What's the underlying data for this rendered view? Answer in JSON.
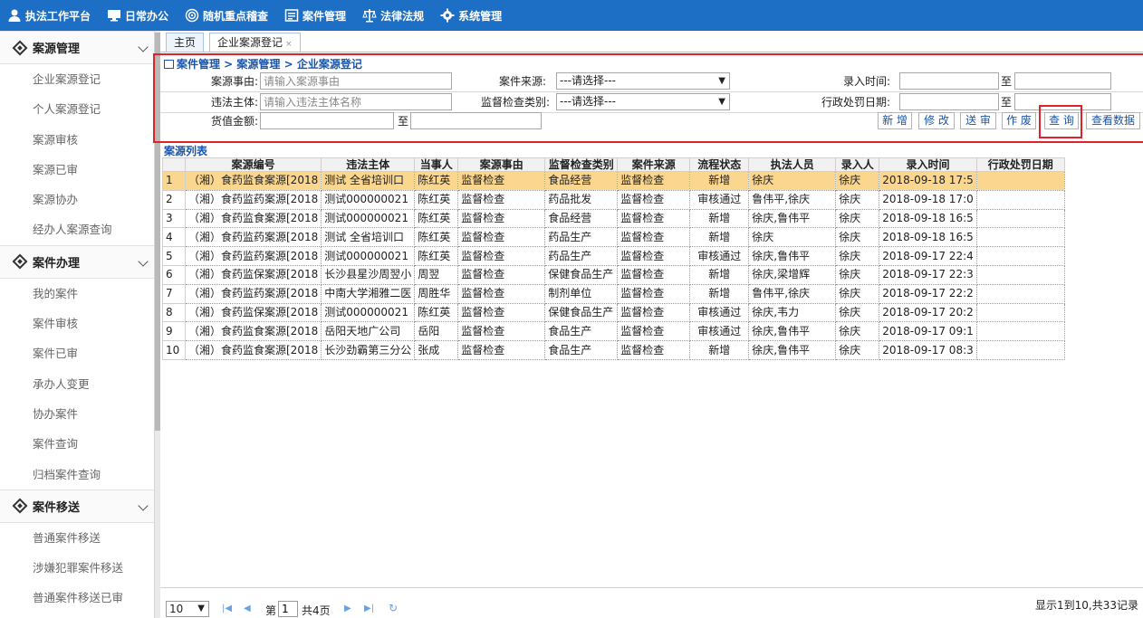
{
  "nav": {
    "items": [
      {
        "label": "执法工作平台",
        "icon": "user-icon"
      },
      {
        "label": "日常办公",
        "icon": "monitor-icon"
      },
      {
        "label": "随机重点稽查",
        "icon": "target-icon"
      },
      {
        "label": "案件管理",
        "icon": "list-icon"
      },
      {
        "label": "法律法规",
        "icon": "scale-icon"
      },
      {
        "label": "系统管理",
        "icon": "gear-icon"
      }
    ]
  },
  "sidebar": {
    "groups": [
      {
        "title": "案源管理",
        "items": [
          "企业案源登记",
          "个人案源登记",
          "案源审核",
          "案源已审",
          "案源协办",
          "经办人案源查询"
        ]
      },
      {
        "title": "案件办理",
        "items": [
          "我的案件",
          "案件审核",
          "案件已审",
          "承办人变更",
          "协办案件",
          "案件查询",
          "归档案件查询"
        ]
      },
      {
        "title": "案件移送",
        "items": [
          "普通案件移送",
          "涉嫌犯罪案件移送",
          "普通案件移送已审"
        ]
      }
    ]
  },
  "tabs": [
    {
      "label": "主页"
    },
    {
      "label": "企业案源登记",
      "close": "×"
    }
  ],
  "breadcrumb": "案件管理 > 案源管理 > 企业案源登记",
  "form": {
    "reason_label": "案源事由:",
    "reason_placeholder": "请输入案源事由",
    "source_label": "案件来源:",
    "source_value": "---请选择---",
    "entry_time_label": "录入时间:",
    "to1": "至",
    "subject_label": "违法主体:",
    "subject_placeholder": "请输入违法主体名称",
    "inspect_label": "监督检查类别:",
    "inspect_value": "---请选择---",
    "penalty_date_label": "行政处罚日期:",
    "to2": "至",
    "amount_label": "货值金额:",
    "to3": "至"
  },
  "buttons": {
    "add": "新 增",
    "edit": "修 改",
    "submit": "送 审",
    "void": "作 废",
    "query": "查 询",
    "view": "查看数据"
  },
  "list_title": "案源列表",
  "table": {
    "headers": [
      "",
      "案源编号",
      "违法主体",
      "当事人",
      "案源事由",
      "监督检查类别",
      "案件来源",
      "流程状态",
      "执法人员",
      "录入人",
      "录入时间",
      "行政处罚日期"
    ],
    "rows": [
      [
        "1",
        "（湘）食药监食案源[2018",
        "测试 全省培训口",
        "陈红英",
        "监督检查",
        "食品经营",
        "监督检查",
        "新增",
        "徐庆",
        "徐庆",
        "2018-09-18 17:5",
        ""
      ],
      [
        "2",
        "（湘）食药监药案源[2018",
        "测试000000021",
        "陈红英",
        "监督检查",
        "药品批发",
        "监督检查",
        "审核通过",
        "鲁伟平,徐庆",
        "徐庆",
        "2018-09-18 17:0",
        ""
      ],
      [
        "3",
        "（湘）食药监食案源[2018",
        "测试000000021",
        "陈红英",
        "监督检查",
        "食品经营",
        "监督检查",
        "新增",
        "徐庆,鲁伟平",
        "徐庆",
        "2018-09-18 16:5",
        ""
      ],
      [
        "4",
        "（湘）食药监药案源[2018",
        "测试 全省培训口",
        "陈红英",
        "监督检查",
        "药品生产",
        "监督检查",
        "新增",
        "徐庆",
        "徐庆",
        "2018-09-18 16:5",
        ""
      ],
      [
        "5",
        "（湘）食药监药案源[2018",
        "测试000000021",
        "陈红英",
        "监督检查",
        "药品生产",
        "监督检查",
        "审核通过",
        "徐庆,鲁伟平",
        "徐庆",
        "2018-09-17 22:4",
        ""
      ],
      [
        "6",
        "（湘）食药监保案源[2018",
        "长沙县星沙周翌小",
        "周翌",
        "监督检查",
        "保健食品生产",
        "监督检查",
        "新增",
        "徐庆,梁增辉",
        "徐庆",
        "2018-09-17 22:3",
        ""
      ],
      [
        "7",
        "（湘）食药监药案源[2018",
        "中南大学湘雅二医",
        "周胜华",
        "监督检查",
        "制剂单位",
        "监督检查",
        "新增",
        "鲁伟平,徐庆",
        "徐庆",
        "2018-09-17 22:2",
        ""
      ],
      [
        "8",
        "（湘）食药监保案源[2018",
        "测试000000021",
        "陈红英",
        "监督检查",
        "保健食品生产",
        "监督检查",
        "审核通过",
        "徐庆,韦力",
        "徐庆",
        "2018-09-17 20:2",
        ""
      ],
      [
        "9",
        "（湘）食药监食案源[2018",
        "岳阳天地广公司",
        "岳阳",
        "监督检查",
        "食品生产",
        "监督检查",
        "审核通过",
        "徐庆,鲁伟平",
        "徐庆",
        "2018-09-17 09:1",
        ""
      ],
      [
        "10",
        "（湘）食药监食案源[2018",
        "长沙劲霸第三分公",
        "张成",
        "监督检查",
        "食品生产",
        "监督检查",
        "新增",
        "徐庆,鲁伟平",
        "徐庆",
        "2018-09-17 08:3",
        ""
      ]
    ]
  },
  "pager": {
    "page_size": "10",
    "page_prefix": "第",
    "page_value": "1",
    "page_suffix": "共4页",
    "info": "显示1到10,共33记录"
  }
}
